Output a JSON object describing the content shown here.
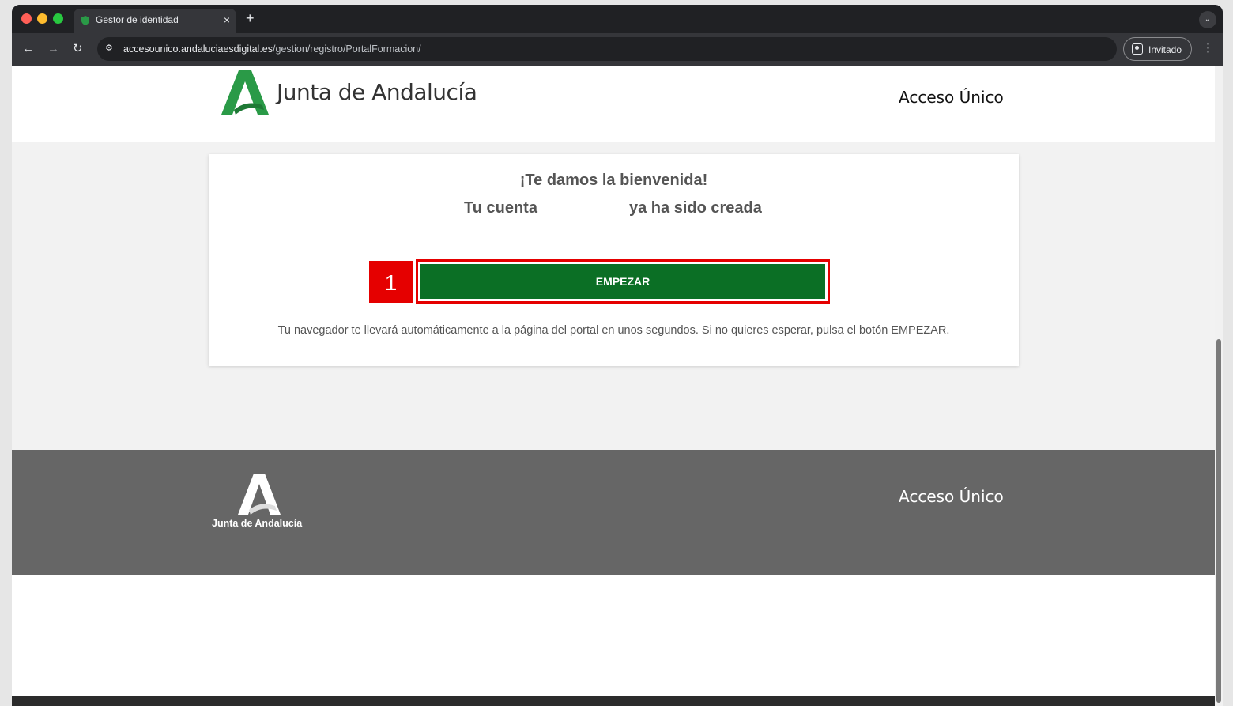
{
  "browser": {
    "tab_title": "Gestor de identidad",
    "tab_close": "×",
    "new_tab": "+",
    "url_host": "accesounico.andaluciaesdigital.es",
    "url_path": "/gestion/registro/PortalFormacion/",
    "profile_label": "Invitado",
    "back": "←",
    "forward": "→",
    "reload": "↻",
    "menu": "⋮",
    "tab_search": "⌄",
    "site_info": "⚙"
  },
  "header": {
    "logo_text": "Junta de Andalucía",
    "right_title": "Acceso Único",
    "brand_color": "#2a9a47"
  },
  "card": {
    "welcome": "¡Te damos la bienvenida!",
    "account_prefix": "Tu cuenta",
    "account_suffix": "ya ha sido creada",
    "step_number": "1",
    "start_button": "EMPEZAR",
    "info": "Tu navegador te llevará automáticamente a la página del portal en unos segundos. Si no quieres esperar, pulsa el botón EMPEZAR.",
    "button_color": "#0b6f25",
    "highlight_color": "#e50000"
  },
  "footer": {
    "logo_text": "Junta de Andalucía",
    "right_title": "Acceso Único"
  }
}
